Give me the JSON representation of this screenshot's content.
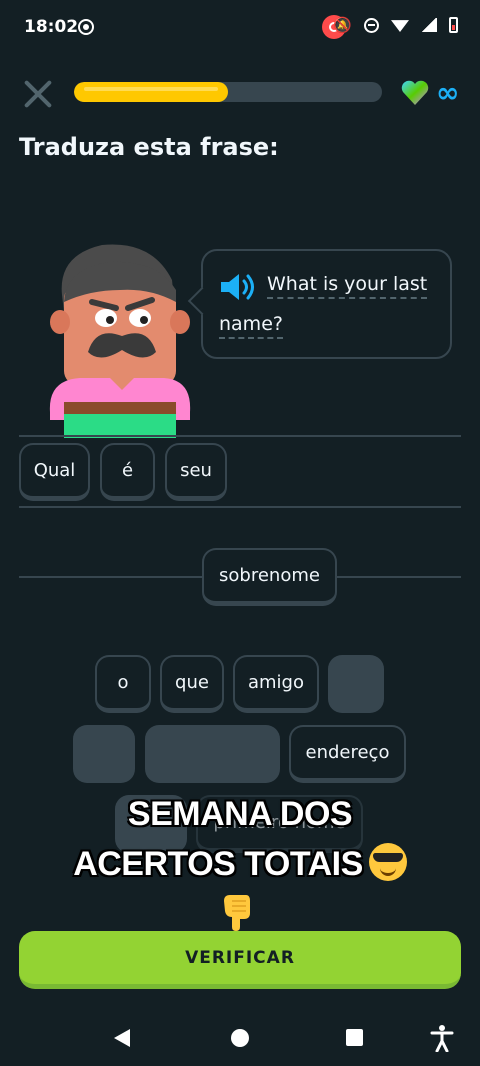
{
  "status_bar": {
    "time": "18:02",
    "icons": [
      "cast-icon",
      "screen-record-icon",
      "notifications-off-icon",
      "do-not-disturb-icon",
      "wifi-icon",
      "signal-icon",
      "battery-low-icon"
    ]
  },
  "lesson": {
    "progress_percent": 50,
    "hearts": "∞",
    "instruction": "Traduza esta frase:",
    "prompt_words_line1": "What is your last",
    "prompt_words_line2": "name?"
  },
  "answer": {
    "selected": [
      "Qual",
      "é",
      "seu",
      "sobrenome"
    ]
  },
  "word_bank": {
    "tiles": [
      "o",
      "que",
      "amigo",
      "endereço",
      "primeiro nome"
    ]
  },
  "overlay": {
    "line1": "SEMANA DOS",
    "line2": "ACERTOS TOTAIS"
  },
  "actions": {
    "check_label": "VERIFICAR"
  },
  "colors": {
    "background": "#131f24",
    "progress": "#ffc800",
    "primary_button": "#93d333",
    "tile_border": "#37464f"
  }
}
